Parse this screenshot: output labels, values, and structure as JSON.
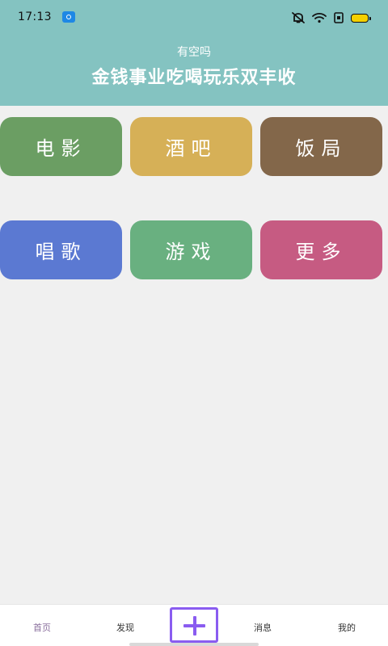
{
  "status_bar": {
    "time": "17:13",
    "icons": [
      "app-notification-icon",
      "mute-icon",
      "wifi-icon",
      "sim-icon",
      "battery-icon"
    ]
  },
  "header": {
    "subtitle": "有空吗",
    "title": "金钱事业吃喝玩乐双丰收"
  },
  "tiles": [
    {
      "label": "电影",
      "color": "#6b9e63"
    },
    {
      "label": "酒吧",
      "color": "#d6b057"
    },
    {
      "label": "饭局",
      "color": "#83674a"
    },
    {
      "label": "唱歌",
      "color": "#5b79d2"
    },
    {
      "label": "游戏",
      "color": "#69b080"
    },
    {
      "label": "更多",
      "color": "#c65b82"
    }
  ],
  "bottom_nav": {
    "items": [
      {
        "label": "首页"
      },
      {
        "label": "发现"
      },
      {
        "label": "消息"
      },
      {
        "label": "我的"
      }
    ],
    "add_icon": "plus-icon"
  },
  "colors": {
    "header": "#84c3c1",
    "background": "#f0f0f0",
    "accent": "#8a5cf0",
    "active_nav": "#8a6f9d"
  }
}
